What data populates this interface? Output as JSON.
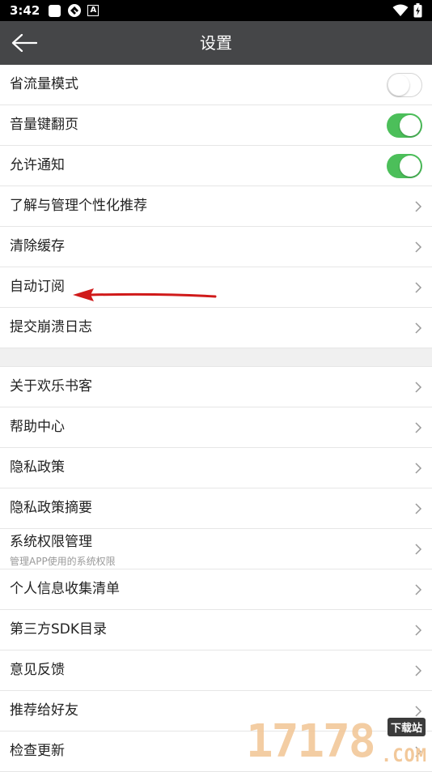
{
  "status_bar": {
    "time": "3:42",
    "left_icons": [
      "square-icon",
      "sync-icon",
      "a-badge-icon"
    ],
    "right_icons": [
      "wifi-icon",
      "battery-charging-icon"
    ],
    "badge_letter": "A"
  },
  "nav": {
    "title": "设置",
    "back_icon": "arrow-left-icon"
  },
  "colors": {
    "nav_bg": "#454648",
    "toggle_on": "#4cbf5a",
    "arrow": "#d01a1a",
    "section_gap": "#f0f0f0"
  },
  "group1": {
    "items": [
      {
        "label": "省流量模式",
        "control": "toggle",
        "on": false
      },
      {
        "label": "音量键翻页",
        "control": "toggle",
        "on": true
      },
      {
        "label": "允许通知",
        "control": "toggle",
        "on": true
      },
      {
        "label": "了解与管理个性化推荐",
        "control": "chevron"
      },
      {
        "label": "清除缓存",
        "control": "chevron"
      },
      {
        "label": "自动订阅",
        "control": "chevron"
      },
      {
        "label": "提交崩溃日志",
        "control": "chevron"
      }
    ]
  },
  "group2": {
    "items": [
      {
        "label": "关于欢乐书客",
        "control": "chevron"
      },
      {
        "label": "帮助中心",
        "control": "chevron"
      },
      {
        "label": "隐私政策",
        "control": "chevron"
      },
      {
        "label": "隐私政策摘要",
        "control": "chevron"
      },
      {
        "label": "系统权限管理",
        "sub": "管理APP使用的系统权限",
        "control": "chevron"
      },
      {
        "label": "个人信息收集清单",
        "control": "chevron"
      },
      {
        "label": "第三方SDK目录",
        "control": "chevron"
      },
      {
        "label": "意见反馈",
        "control": "chevron"
      },
      {
        "label": "推荐给好友",
        "control": "chevron"
      },
      {
        "label": "检查更新",
        "control": "chevron"
      }
    ]
  },
  "watermark": {
    "digits": "17178",
    "badge": "下载站",
    "domain": ".COM"
  }
}
